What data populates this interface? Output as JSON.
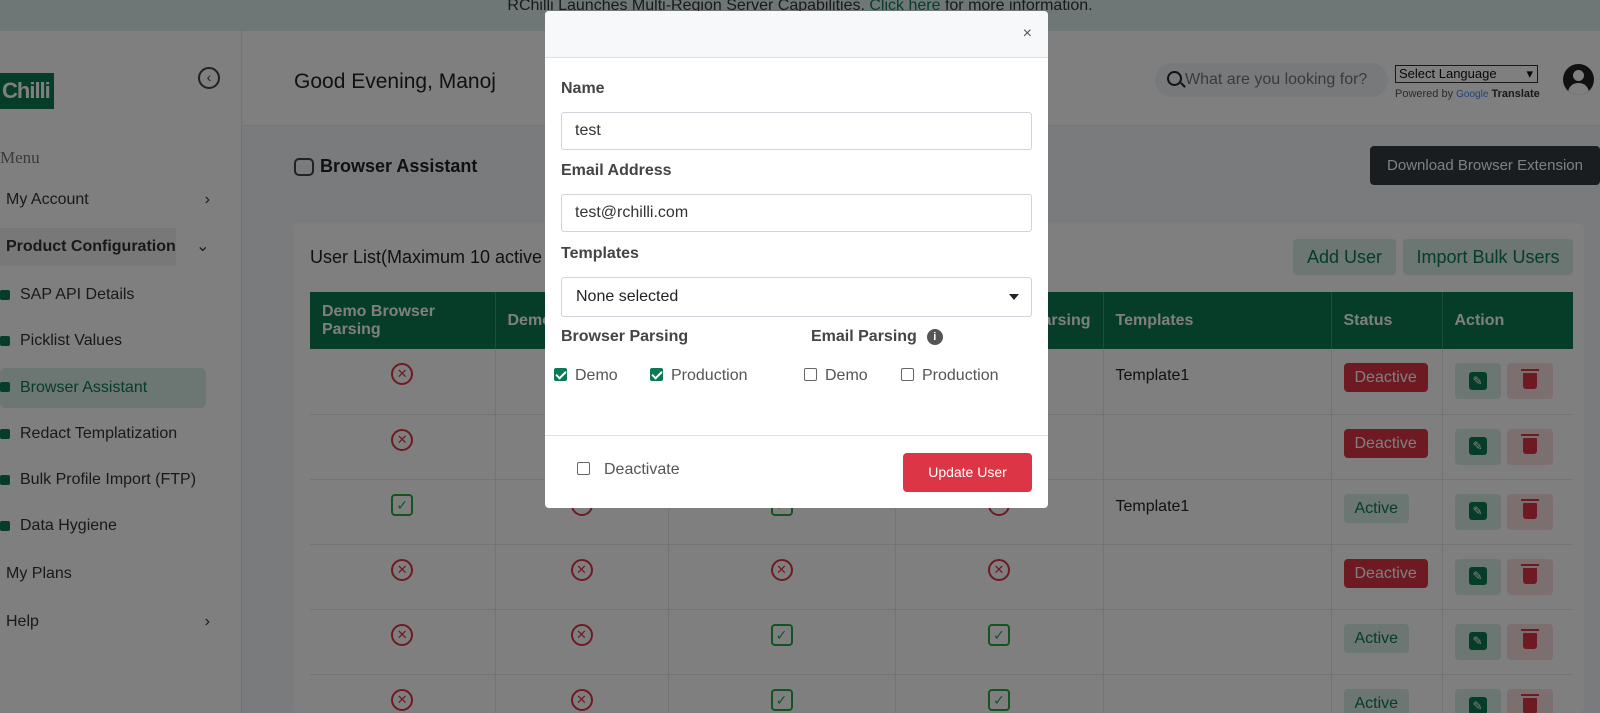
{
  "banner": {
    "text": "RChilli Launches Multi-Region Server Capabilities. ",
    "link": "Click here",
    "suffix": " for more information."
  },
  "sidebar": {
    "logo": "Chilli",
    "menu_heading": "Menu",
    "items": [
      {
        "label": "My Account"
      },
      {
        "label": "Product Configuration"
      },
      {
        "label": "SAP API Details"
      },
      {
        "label": "Picklist Values"
      },
      {
        "label": "Browser Assistant"
      },
      {
        "label": "Redact Templatization"
      },
      {
        "label": "Bulk Profile Import (FTP)"
      },
      {
        "label": "Data Hygiene"
      },
      {
        "label": "My Plans"
      },
      {
        "label": "Help"
      }
    ]
  },
  "header": {
    "greeting": "Good Evening, Manoj",
    "search_placeholder": "What are you looking for?",
    "language_select": "Select Language",
    "powered_by": "Powered by",
    "google": "Google",
    "translate": "Translate"
  },
  "page": {
    "title": "Browser Assistant",
    "download_button": "Download Browser Extension",
    "list_title": "User List(Maximum 10 active",
    "add_user": "Add User",
    "import_bulk": "Import Bulk Users"
  },
  "table": {
    "headers": [
      "Demo Browser Parsing",
      "Demo",
      "",
      "arsing",
      "Templates",
      "Status",
      "Action"
    ],
    "rows": [
      {
        "c1": "x",
        "c2": "",
        "c3": "",
        "c4": "",
        "template": "Template1",
        "status": "Deactive"
      },
      {
        "c1": "x",
        "c2": "",
        "c3": "",
        "c4": "",
        "template": "",
        "status": "Deactive"
      },
      {
        "c1": "check",
        "c2": "x",
        "c3": "check",
        "c4": "x",
        "template": "Template1",
        "status": "Active"
      },
      {
        "c1": "x",
        "c2": "x",
        "c3": "x",
        "c4": "x",
        "template": "",
        "status": "Deactive"
      },
      {
        "c1": "x",
        "c2": "x",
        "c3": "check",
        "c4": "check",
        "template": "",
        "status": "Active"
      },
      {
        "c1": "x",
        "c2": "x",
        "c3": "check",
        "c4": "check",
        "template": "",
        "status": "Active"
      }
    ]
  },
  "modal": {
    "close": "×",
    "name_label": "Name",
    "name_value": "test",
    "email_label": "Email Address",
    "email_value": "test@rchilli.com",
    "templates_label": "Templates",
    "templates_value": "None selected",
    "browser_parsing_label": "Browser Parsing",
    "email_parsing_label": "Email Parsing",
    "demo": "Demo",
    "production": "Production",
    "browser_demo_checked": true,
    "browser_production_checked": true,
    "email_demo_checked": false,
    "email_production_checked": false,
    "deactivate_label": "Deactivate",
    "deactivate_checked": false,
    "update_button": "Update User"
  },
  "colors": {
    "brand": "#0b7a52",
    "danger": "#dc3545",
    "dark": "#343a40"
  }
}
